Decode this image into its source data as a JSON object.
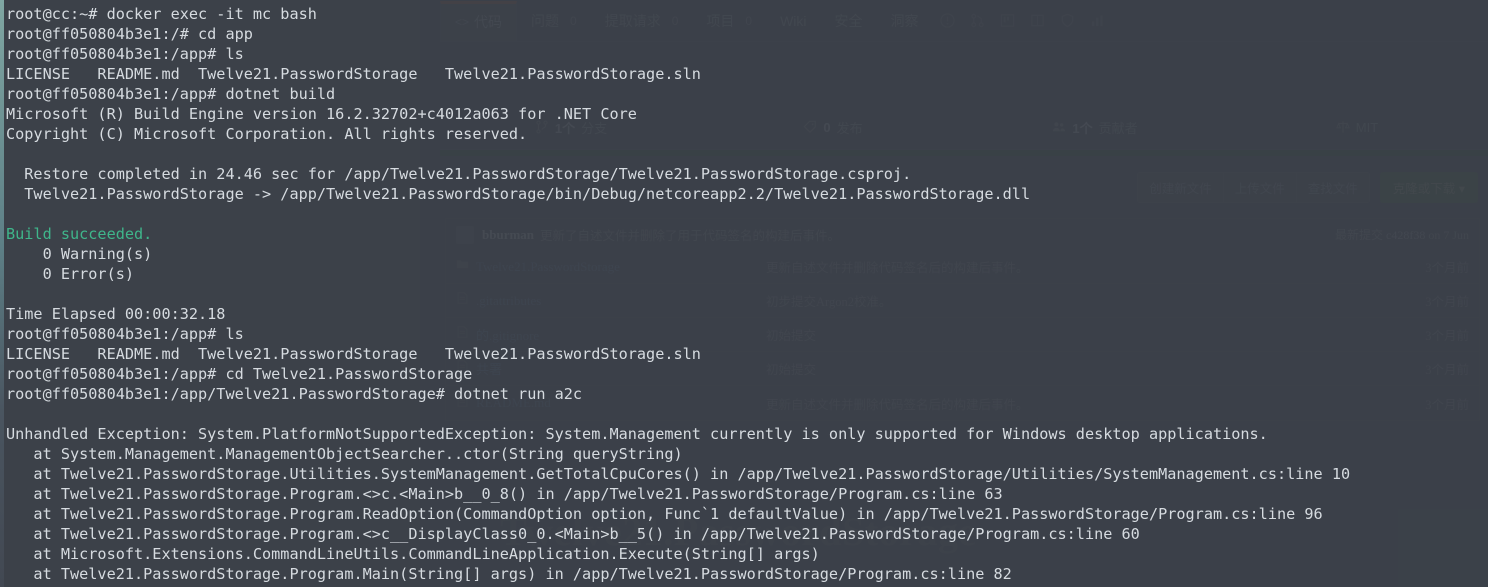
{
  "background_page": {
    "nav_tabs": [
      {
        "label": "代码",
        "icon": "code-icon",
        "count": "",
        "active": true
      },
      {
        "label": "问题",
        "icon": "",
        "count": "0",
        "active": false
      },
      {
        "label": "提取请求",
        "icon": "",
        "count": "0",
        "active": false
      },
      {
        "label": "项目",
        "icon": "",
        "count": "0",
        "active": false
      },
      {
        "label": "Wiki",
        "icon": "",
        "count": "",
        "active": false
      },
      {
        "label": "安全",
        "icon": "",
        "count": "",
        "active": false
      },
      {
        "label": "洞察",
        "icon": "",
        "count": "",
        "active": false
      }
    ],
    "nav_extra_icons": [
      "issue-opened-icon",
      "git-pull-request-icon",
      "project-board-icon",
      "book-icon",
      "shield-icon",
      "graph-icon"
    ],
    "stats": [
      {
        "icon": "git-branch-icon",
        "value": "1个",
        "label": "分支"
      },
      {
        "icon": "tag-icon",
        "value": "0",
        "label": "发布"
      },
      {
        "icon": "people-icon",
        "value": "1个",
        "label": "贡献者"
      },
      {
        "icon": "law-icon",
        "value": "",
        "label": "MIT"
      }
    ],
    "actions": {
      "new_file": "创建新文件",
      "upload_file": "上传文件",
      "find_file": "查找文件",
      "clone_download": "克隆或下载 ▾"
    },
    "latest_commit": {
      "author": "bburman",
      "message": "更新了自述文件并删除了用于代码签名的构建后事件。",
      "label": "最新提交",
      "sha": "c428f38",
      "date": "on 7 Jun"
    },
    "file_columns": [
      "name",
      "message",
      "time"
    ],
    "files": [
      {
        "icon": "folder-icon",
        "name": "Twelve21.PasswordStorage",
        "message": "更新自述文件并删除代码签名后的构建后事件。",
        "time": "3个月前"
      },
      {
        "icon": "file-icon",
        "name": ".gitattributes",
        "message": "初步提交Argon2校准。",
        "time": "3个月前"
      },
      {
        "icon": "file-icon",
        "name": "的.gitignore",
        "message": "初始提交",
        "time": "3个月前"
      },
      {
        "icon": "file-icon",
        "name": "共署",
        "message": "初始提交",
        "time": "3个月前"
      },
      {
        "icon": "file-icon",
        "name": "README.md",
        "message": "更新自述文件并删除代码签名后的构建后事件。",
        "time": "3个月前"
      }
    ],
    "watermark_title": "Twelve21.PasswordStorage"
  },
  "terminal": {
    "lines": [
      {
        "text": "root@cc:~# docker exec -it mc bash",
        "color": "default"
      },
      {
        "text": "root@ff050804b3e1:/# cd app",
        "color": "default"
      },
      {
        "text": "root@ff050804b3e1:/app# ls",
        "color": "default"
      },
      {
        "text": "LICENSE   README.md  Twelve21.PasswordStorage   Twelve21.PasswordStorage.sln",
        "color": "default"
      },
      {
        "text": "root@ff050804b3e1:/app# dotnet build",
        "color": "default"
      },
      {
        "text": "Microsoft (R) Build Engine version 16.2.32702+c4012a063 for .NET Core",
        "color": "default"
      },
      {
        "text": "Copyright (C) Microsoft Corporation. All rights reserved.",
        "color": "default"
      },
      {
        "text": "",
        "color": "default"
      },
      {
        "text": "  Restore completed in 24.46 sec for /app/Twelve21.PasswordStorage/Twelve21.PasswordStorage.csproj.",
        "color": "default"
      },
      {
        "text": "  Twelve21.PasswordStorage -> /app/Twelve21.PasswordStorage/bin/Debug/netcoreapp2.2/Twelve21.PasswordStorage.dll",
        "color": "default"
      },
      {
        "text": "",
        "color": "default"
      },
      {
        "text": "Build succeeded.",
        "color": "green"
      },
      {
        "text": "    0 Warning(s)",
        "color": "default"
      },
      {
        "text": "    0 Error(s)",
        "color": "default"
      },
      {
        "text": "",
        "color": "default"
      },
      {
        "text": "Time Elapsed 00:00:32.18",
        "color": "default"
      },
      {
        "text": "root@ff050804b3e1:/app# ls",
        "color": "default"
      },
      {
        "text": "LICENSE   README.md  Twelve21.PasswordStorage   Twelve21.PasswordStorage.sln",
        "color": "default"
      },
      {
        "text": "root@ff050804b3e1:/app# cd Twelve21.PasswordStorage",
        "color": "default"
      },
      {
        "text": "root@ff050804b3e1:/app/Twelve21.PasswordStorage# dotnet run a2c",
        "color": "default"
      },
      {
        "text": "",
        "color": "default"
      },
      {
        "text": "Unhandled Exception: System.PlatformNotSupportedException: System.Management currently is only supported for Windows desktop applications.",
        "color": "default"
      },
      {
        "text": "   at System.Management.ManagementObjectSearcher..ctor(String queryString)",
        "color": "default"
      },
      {
        "text": "   at Twelve21.PasswordStorage.Utilities.SystemManagement.GetTotalCpuCores() in /app/Twelve21.PasswordStorage/Utilities/SystemManagement.cs:line 10",
        "color": "default"
      },
      {
        "text": "   at Twelve21.PasswordStorage.Program.<>c.<Main>b__0_8() in /app/Twelve21.PasswordStorage/Program.cs:line 63",
        "color": "default"
      },
      {
        "text": "   at Twelve21.PasswordStorage.Program.ReadOption(CommandOption option, Func`1 defaultValue) in /app/Twelve21.PasswordStorage/Program.cs:line 96",
        "color": "default"
      },
      {
        "text": "   at Twelve21.PasswordStorage.Program.<>c__DisplayClass0_0.<Main>b__5() in /app/Twelve21.PasswordStorage/Program.cs:line 60",
        "color": "default"
      },
      {
        "text": "   at Microsoft.Extensions.CommandLineUtils.CommandLineApplication.Execute(String[] args)",
        "color": "default"
      },
      {
        "text": "   at Twelve21.PasswordStorage.Program.Main(String[] args) in /app/Twelve21.PasswordStorage/Program.cs:line 82",
        "color": "default"
      }
    ]
  },
  "colors": {
    "terminal_bg": "#3b4048",
    "terminal_text": "#d6dbe0",
    "success_green": "#3fb68b",
    "page_bg": "#3f4550",
    "link_blue": "#4f6382",
    "active_tab_accent": "#7c4a3c",
    "clone_button_green": "#3a5a47"
  }
}
